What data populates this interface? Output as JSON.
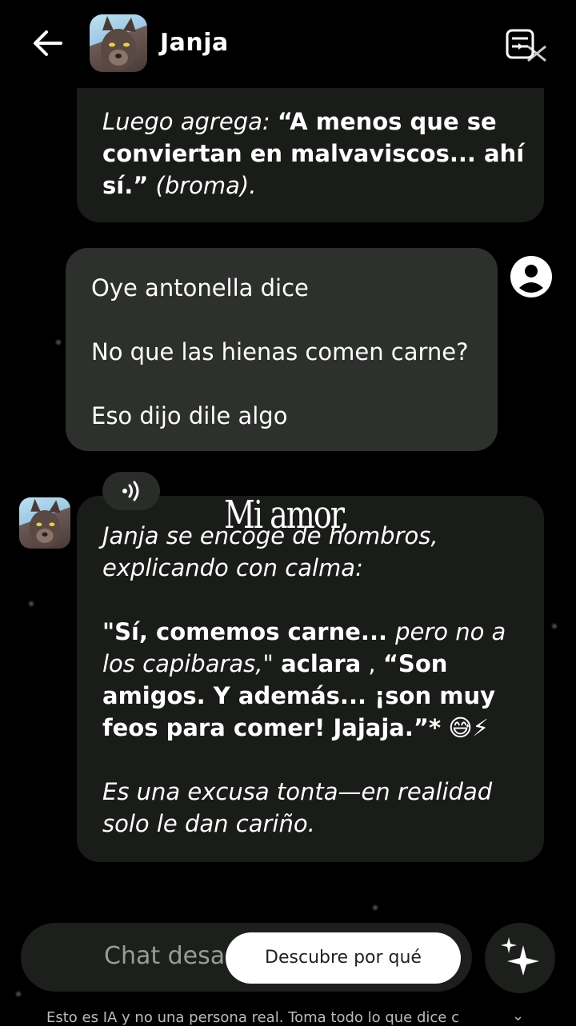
{
  "header": {
    "name": "Janja"
  },
  "messages": {
    "m1": {
      "p1_i": "Luego agrega: ",
      "p1_b": "“A menos que se conviertan en malvaviscos... ahí sí.”",
      "p1_i2": " (broma)."
    },
    "m2": {
      "lines": [
        "Oye antonella dice",
        "No que las hienas comen carne?",
        "Eso dijo dile algo"
      ]
    },
    "m3": {
      "p1": "Janja se encoge de hombros, explicando con calma:",
      "p2_b1": "\"Sí, comemos carne... ",
      "p2_i": "pero no a los capibaras,\" ",
      "p2_b2": "aclara",
      "p2_plain": " , ",
      "p2_b3": "“Son amigos. Y además... ¡son muy feos para comer! Jajaja.”*",
      "p2_emoji": " 😅⚡",
      "p3": "Es una excusa tonta—en realidad solo le dan cariño."
    }
  },
  "overlay": {
    "text": "Mi amor,"
  },
  "input": {
    "placeholder": "Chat desa",
    "discover_label": "Descubre por qué"
  },
  "footer": {
    "disclaimer": "Esto es IA y no una persona real. Toma todo lo que dice c"
  },
  "icons": {
    "back": "arrow-left-icon",
    "header_action": "reels-mute-icon",
    "user": "account-circle-icon",
    "audio": "speaker-icon",
    "sparkle": "sparkle-icon",
    "chevron": "chevron-down-icon"
  }
}
